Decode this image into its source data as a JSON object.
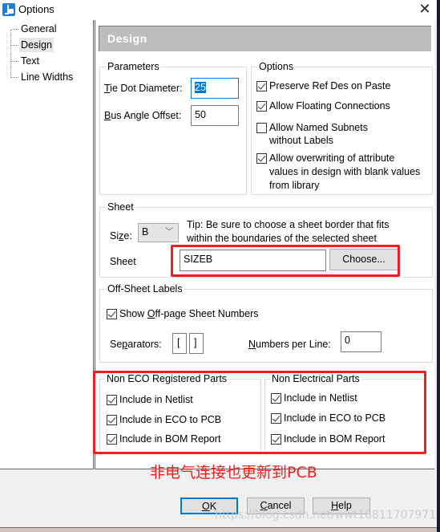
{
  "window": {
    "title": "Options",
    "close_icon": "close-icon"
  },
  "tree": {
    "items": [
      {
        "label": "General",
        "selected": false
      },
      {
        "label": "Design",
        "selected": true
      },
      {
        "label": "Text",
        "selected": false
      },
      {
        "label": "Line Widths",
        "selected": false
      }
    ]
  },
  "page": {
    "header": "Design"
  },
  "parameters": {
    "legend": "Parameters",
    "tie_dot": {
      "label_u": "T",
      "label_rest": "ie Dot Diameter:",
      "value": "25"
    },
    "bus_angle": {
      "label_u": "B",
      "label_rest": "us Angle Offset:",
      "value": "50"
    }
  },
  "options": {
    "legend": "Options",
    "items": [
      {
        "label": "Preserve Ref Des on Paste",
        "checked": true
      },
      {
        "label": "Allow Floating Connections",
        "checked": true
      },
      {
        "label_line1": "Allow Named Subnets",
        "label_line2": "without Labels",
        "checked": false
      },
      {
        "label_line1": "Allow overwriting of attribute",
        "label_line2": "values in design with blank values",
        "label_line3": "from library",
        "checked": true
      }
    ]
  },
  "sheet": {
    "legend": "Sheet",
    "size_label_pre": "Si",
    "size_label_u": "z",
    "size_label_post": "e:",
    "size_value": "B",
    "tip_line1": "Tip: Be sure to choose a sheet border that fits",
    "tip_line2": "within the boundaries of the selected sheet",
    "sheet_label": "Sheet",
    "sheet_value": "SIZEB",
    "choose_button": "Choose..."
  },
  "off_sheet": {
    "legend": "Off-Sheet Labels",
    "show_pre": "Show ",
    "show_u": "O",
    "show_post": "ff-page Sheet Numbers",
    "show_checked": true,
    "separators_pre": "Se",
    "separators_u": "p",
    "separators_post": "arators:",
    "sep_open": "[",
    "sep_close": "]",
    "numbers_u": "N",
    "numbers_post": "umbers per Line:",
    "numbers_value": "0"
  },
  "non_eco": {
    "legend": "Non ECO Registered Parts",
    "items": [
      {
        "label": "Include in Netlist",
        "checked": true
      },
      {
        "label": "Include in ECO to PCB",
        "checked": true
      },
      {
        "label": "Include in BOM Report",
        "checked": true
      }
    ]
  },
  "non_electrical": {
    "legend": "Non Electrical Parts",
    "items": [
      {
        "label": "Include in Netlist",
        "checked": true
      },
      {
        "label": "Include in ECO to PCB",
        "checked": true
      },
      {
        "label": "Include in BOM Report",
        "checked": true
      }
    ]
  },
  "annotation": {
    "text": "非电气连接也更新到PCB",
    "color": "#f21d1d"
  },
  "buttons": {
    "ok_u": "O",
    "ok_post": "K",
    "cancel_u": "C",
    "cancel_post": "ancel",
    "help_u": "H",
    "help_post": "elp"
  },
  "watermark": "https://blog.csdn.net/wwt18811707971",
  "colors": {
    "accent": "#0078d7",
    "header_bg": "#bdbdbd",
    "highlight_red": "#f21d1d"
  }
}
